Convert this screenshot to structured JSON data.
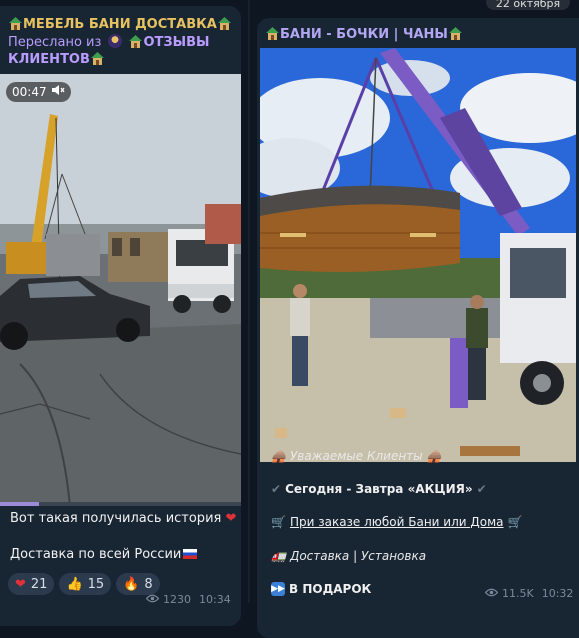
{
  "left_post": {
    "channel_title": "МЕБЕЛЬ БАНИ ДОСТАВКА",
    "forwarded_prefix": "Переслано из",
    "forwarded_from": "ОТЗЫВЫ КЛИЕНТОВ",
    "video_duration": "00:47",
    "video_progress_percent": 16,
    "text_line_1": "Вот такая получилась история",
    "text_line_2": "Доставка по всей России",
    "reactions": [
      {
        "icon": "heart-icon",
        "glyph": "❤️",
        "count": "21"
      },
      {
        "icon": "thumbs-up-icon",
        "glyph": "👍",
        "count": "15"
      },
      {
        "icon": "fire-icon",
        "glyph": "🔥",
        "count": "8"
      }
    ],
    "views": "1230",
    "time": "10:34"
  },
  "right_post": {
    "date_chip": "22 октября",
    "channel_title": "БАНИ - БОЧКИ | ЧАНЫ",
    "lines": [
      {
        "text": "Уважаемые Клиенты",
        "style": "italic"
      },
      {
        "text": "Сегодня - Завтра «АКЦИЯ»",
        "style": "bold"
      },
      {
        "text": "При заказе любой Бани или Дома",
        "style": "underline"
      },
      {
        "text": "Доставка | Установка",
        "style": "italic"
      },
      {
        "text": "В ПОДАРОК",
        "style": "bold"
      }
    ],
    "views": "11.5K",
    "time": "10:32"
  },
  "colors": {
    "background": "#0e1621",
    "bubble": "#182533",
    "left_title": "#e6c260",
    "right_title": "#b3a6f2",
    "forwarded": "#b89cff",
    "meta": "#7a8a9a"
  }
}
